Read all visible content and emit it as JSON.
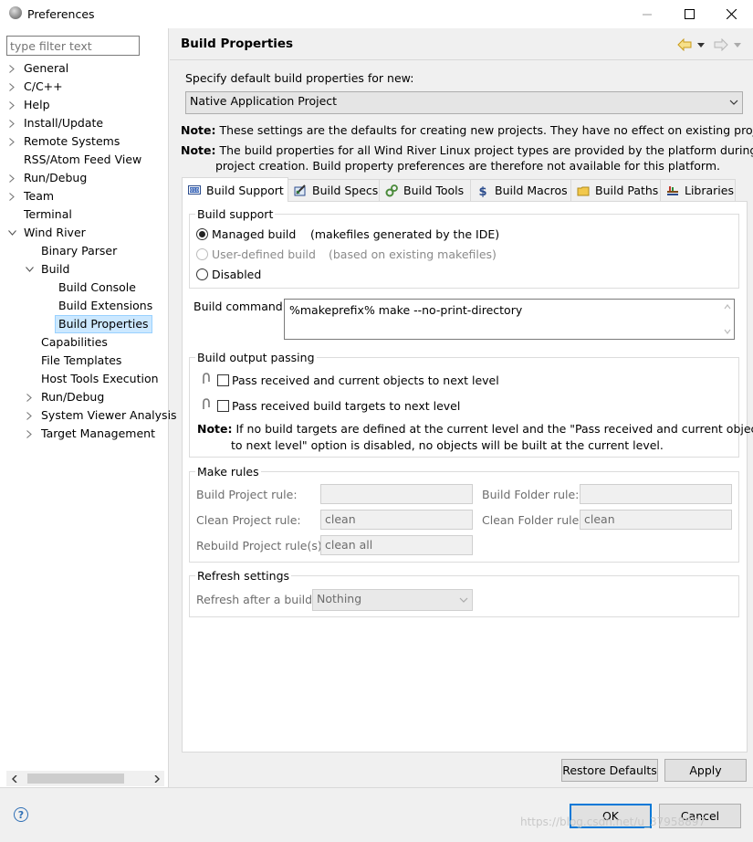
{
  "window": {
    "title": "Preferences"
  },
  "filter": {
    "placeholder": "type filter text"
  },
  "tree": [
    {
      "label": "General",
      "depth": 0,
      "expander": "collapsed"
    },
    {
      "label": "C/C++",
      "depth": 0,
      "expander": "collapsed"
    },
    {
      "label": "Help",
      "depth": 0,
      "expander": "collapsed"
    },
    {
      "label": "Install/Update",
      "depth": 0,
      "expander": "collapsed"
    },
    {
      "label": "Remote Systems",
      "depth": 0,
      "expander": "collapsed"
    },
    {
      "label": "RSS/Atom Feed View",
      "depth": 0,
      "expander": "none"
    },
    {
      "label": "Run/Debug",
      "depth": 0,
      "expander": "collapsed"
    },
    {
      "label": "Team",
      "depth": 0,
      "expander": "collapsed"
    },
    {
      "label": "Terminal",
      "depth": 0,
      "expander": "none"
    },
    {
      "label": "Wind River",
      "depth": 0,
      "expander": "expanded"
    },
    {
      "label": "Binary Parser",
      "depth": 1,
      "expander": "none"
    },
    {
      "label": "Build",
      "depth": 1,
      "expander": "expanded"
    },
    {
      "label": "Build Console",
      "depth": 2,
      "expander": "none"
    },
    {
      "label": "Build Extensions",
      "depth": 2,
      "expander": "none"
    },
    {
      "label": "Build Properties",
      "depth": 2,
      "expander": "none",
      "selected": true
    },
    {
      "label": "Capabilities",
      "depth": 1,
      "expander": "none"
    },
    {
      "label": "File Templates",
      "depth": 1,
      "expander": "none"
    },
    {
      "label": "Host Tools Execution",
      "depth": 1,
      "expander": "none"
    },
    {
      "label": "Run/Debug",
      "depth": 1,
      "expander": "collapsed"
    },
    {
      "label": "System Viewer Analysis",
      "depth": 1,
      "expander": "collapsed"
    },
    {
      "label": "Target Management",
      "depth": 1,
      "expander": "collapsed"
    }
  ],
  "page": {
    "title": "Build Properties",
    "specify_label": "Specify default build properties for new:",
    "project_type": "Native Application Project",
    "note1_prefix": "Note:",
    "note1_text": "These settings are the defaults for creating new projects. They have no effect on existing projects.",
    "note2_prefix": "Note:",
    "note2_line1": "The build properties for all Wind River Linux project types are provided by the platform during",
    "note2_line2": "project creation. Build property preferences are therefore not available for this platform."
  },
  "tabs": [
    {
      "label": "Build Support",
      "icon": "build-support-icon",
      "active": true
    },
    {
      "label": "Build Specs",
      "icon": "build-specs-icon"
    },
    {
      "label": "Build Tools",
      "icon": "build-tools-icon"
    },
    {
      "label": "Build Macros",
      "icon": "build-macros-icon"
    },
    {
      "label": "Build Paths",
      "icon": "build-paths-icon"
    },
    {
      "label": "Libraries",
      "icon": "libraries-icon"
    }
  ],
  "build_support": {
    "group_title": "Build support",
    "managed_label": "Managed build",
    "managed_desc": "(makefiles generated by the IDE)",
    "user_label": "User-defined build",
    "user_desc": "(based on existing makefiles)",
    "disabled_label": "Disabled",
    "selected": "managed"
  },
  "build_command": {
    "label": "Build command:",
    "value": "%makeprefix% make --no-print-directory"
  },
  "output_passing": {
    "group_title": "Build output passing",
    "option1": "Pass received and current objects to next level",
    "option2": "Pass received build targets to next level",
    "note_prefix": "Note:",
    "note_line1": "If no build targets are defined at the current level and the \"Pass received and current objects",
    "note_line2": "to next level\" option is disabled, no objects will be built at the current level."
  },
  "make_rules": {
    "group_title": "Make rules",
    "build_project_label": "Build Project rule:",
    "build_project_value": "",
    "build_folder_label": "Build Folder rule:",
    "build_folder_value": "",
    "clean_project_label": "Clean Project rule:",
    "clean_project_value": "clean",
    "clean_folder_label": "Clean Folder rule:",
    "clean_folder_value": "clean",
    "rebuild_project_label": "Rebuild Project rule(s):",
    "rebuild_project_value": "clean all"
  },
  "refresh": {
    "group_title": "Refresh settings",
    "label": "Refresh after a build:",
    "value": "Nothing"
  },
  "buttons": {
    "restore": "Restore Defaults",
    "apply": "Apply",
    "ok": "OK",
    "cancel": "Cancel"
  },
  "watermark": "https://blog.csdn.net/u_37958897"
}
